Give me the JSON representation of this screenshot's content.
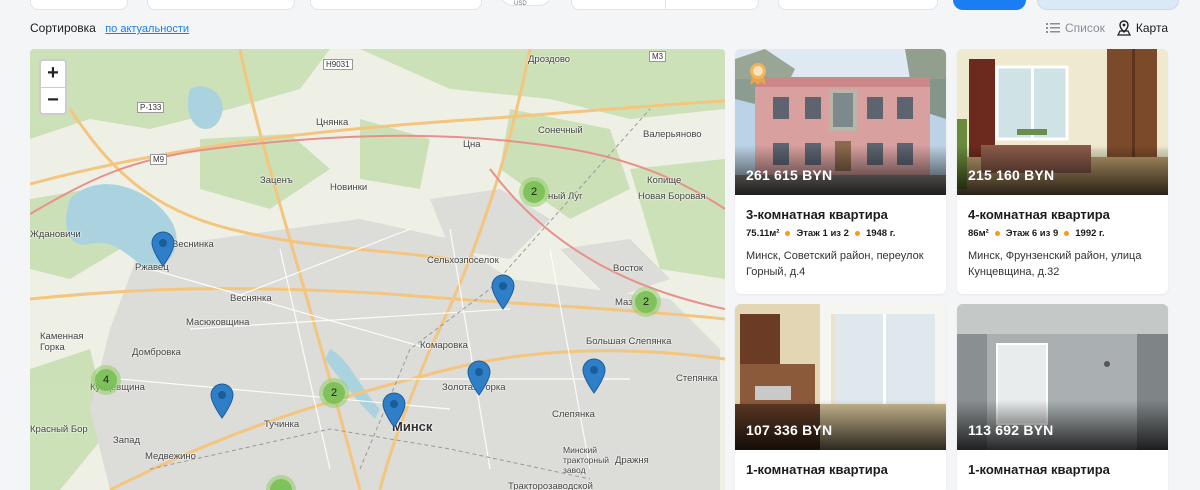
{
  "topbar": {
    "currency": "USD"
  },
  "sort": {
    "label": "Сортировка",
    "value": "по актуальности"
  },
  "view": {
    "list": "Список",
    "map": "Карта"
  },
  "map": {
    "zoom_in": "+",
    "zoom_out": "−",
    "labels": {
      "drozdovo": "Дроздово",
      "h9031": "H9031",
      "m3": "M3",
      "p133": "P-133",
      "cnyanka": "Цнянка",
      "sonechny": "Сонечный",
      "valeryanovo": "Валерьяново",
      "m9": "M9",
      "cna": "Цна",
      "zacen": "Заценъ",
      "novinki": "Новинки",
      "luh": "ный Луг",
      "kopishche": "Копище",
      "nb": "Новая Боровая",
      "zhdanovichi": "Ждановичи",
      "lesninka": "Веснинка",
      "rzhavec": "Ржавец",
      "selkhoz": "Сельхозпоселок",
      "vostok": "Восток",
      "vesnyanka": "Веснянка",
      "masyukovshchina": "Масюковщина",
      "maz": "Маз",
      "kamgorka": "Каменная Горка",
      "dombrovka": "Домбровка",
      "komarovka": "Комаровка",
      "bolshaya": "Большая Слепянка",
      "kuntsevshchina": "Кунцевщина",
      "zolotaya": "Золотая Горка",
      "stepyanka": "Степянка",
      "krasnybor": "Красный Бор",
      "tuchinka": "Тучинка",
      "minsk": "Минск",
      "slepyanka": "Слепянка",
      "zapad": "Запад",
      "medvezhino": "Медвежино",
      "mtz": "Минский тракторный завод",
      "drazhnya": "Дражня",
      "traktorozavodskoy": "Тракторозаводской"
    },
    "clusters": [
      "2",
      "2",
      "4",
      "2"
    ]
  },
  "listings": [
    {
      "price": "261 615 BYN",
      "title": "3-комнатная квартира",
      "area": "75.11м²",
      "floor": "Этаж 1 из 2",
      "year": "1948 г.",
      "address": "Минск, Советский район, переулок Горный, д.4"
    },
    {
      "price": "215 160 BYN",
      "title": "4-комнатная квартира",
      "area": "86м²",
      "floor": "Этаж 6 из 9",
      "year": "1992 г.",
      "address": "Минск, Фрунзенский район, улица Кунцевщина, д.32"
    },
    {
      "price": "107 336 BYN",
      "title": "1-комнатная квартира"
    },
    {
      "price": "113 692 BYN",
      "title": "1-комнатная квартира"
    }
  ],
  "colors": {
    "accent": "#1a7df2",
    "dot": "#f59a23",
    "pin": "#2f7fc8"
  }
}
